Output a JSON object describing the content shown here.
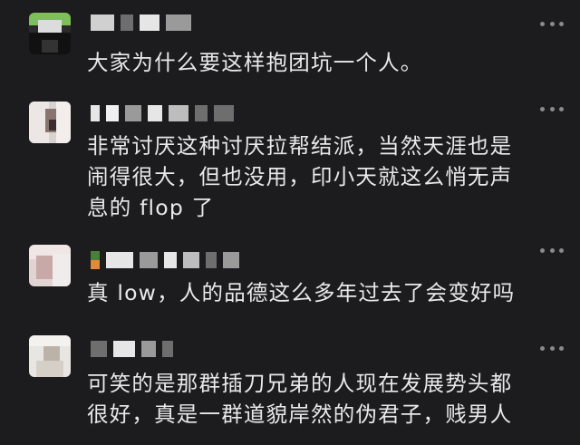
{
  "comments": [
    {
      "text_lines": [
        "大家为什么要这样抱团坑一个人。"
      ]
    },
    {
      "text_lines": [
        "非常讨厌这种讨厌拉帮结派，当然天涯也是",
        "闹得很大，但也没用，印小天就这么悄无声",
        "息的 flop 了"
      ]
    },
    {
      "text_lines": [
        "真 low，人的品德这么多年过去了会变好吗"
      ]
    },
    {
      "text_lines": [
        "可笑的是那群插刀兄弟的人现在发展势头都",
        "很好，真是一群道貌岸然的伪君子，贱男人"
      ]
    }
  ],
  "icons": {
    "more": "more-dots-icon"
  },
  "colors": {
    "background": "#1c1c1e",
    "text": "#e9e9ea",
    "more_dots": "#8a8a8e",
    "censor": "#bdbdbd"
  }
}
